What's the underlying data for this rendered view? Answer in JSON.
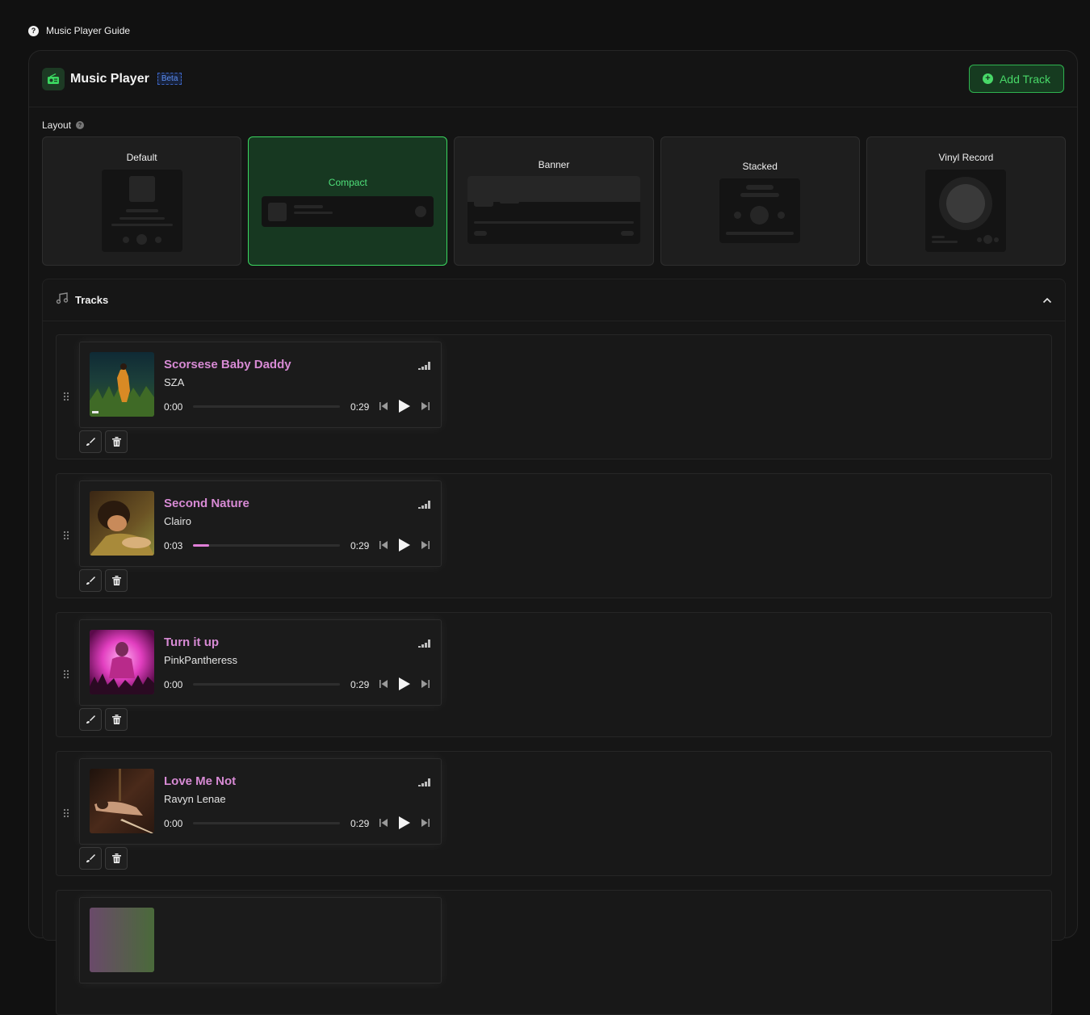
{
  "guide": {
    "label": "Music Player Guide"
  },
  "header": {
    "title": "Music Player",
    "badge": "Beta",
    "add_label": "Add Track"
  },
  "layout": {
    "label": "Layout",
    "options": [
      {
        "name": "Default",
        "selected": false
      },
      {
        "name": "Compact",
        "selected": true
      },
      {
        "name": "Banner",
        "selected": false
      },
      {
        "name": "Stacked",
        "selected": false
      },
      {
        "name": "Vinyl Record",
        "selected": false
      }
    ]
  },
  "tracks": {
    "title": "Tracks",
    "items": [
      {
        "title": "Scorsese Baby Daddy",
        "artist": "SZA",
        "current": "0:00",
        "duration": "0:29",
        "progress": 0.0
      },
      {
        "title": "Second Nature",
        "artist": "Clairo",
        "current": "0:03",
        "duration": "0:29",
        "progress": 0.11
      },
      {
        "title": "Turn it up",
        "artist": "PinkPantheress",
        "current": "0:00",
        "duration": "0:29",
        "progress": 0.0
      },
      {
        "title": "Love Me Not",
        "artist": "Ravyn Lenae",
        "current": "0:00",
        "duration": "0:29",
        "progress": 0.0
      }
    ]
  },
  "colors": {
    "accent": "#3bd760",
    "track_title": "#d78ad4",
    "progress": "#e07fd8"
  },
  "icons": {
    "guide": "question-circle-icon",
    "app": "radio-icon",
    "add": "plus-circle-icon",
    "tracks": "music-note-icon",
    "collapse": "chevron-up-icon",
    "drag": "drag-handle-icon",
    "eq": "equalizer-icon",
    "prev": "skip-back-icon",
    "play": "play-icon",
    "next": "skip-forward-icon",
    "edit": "brush-icon",
    "delete": "trash-icon"
  }
}
